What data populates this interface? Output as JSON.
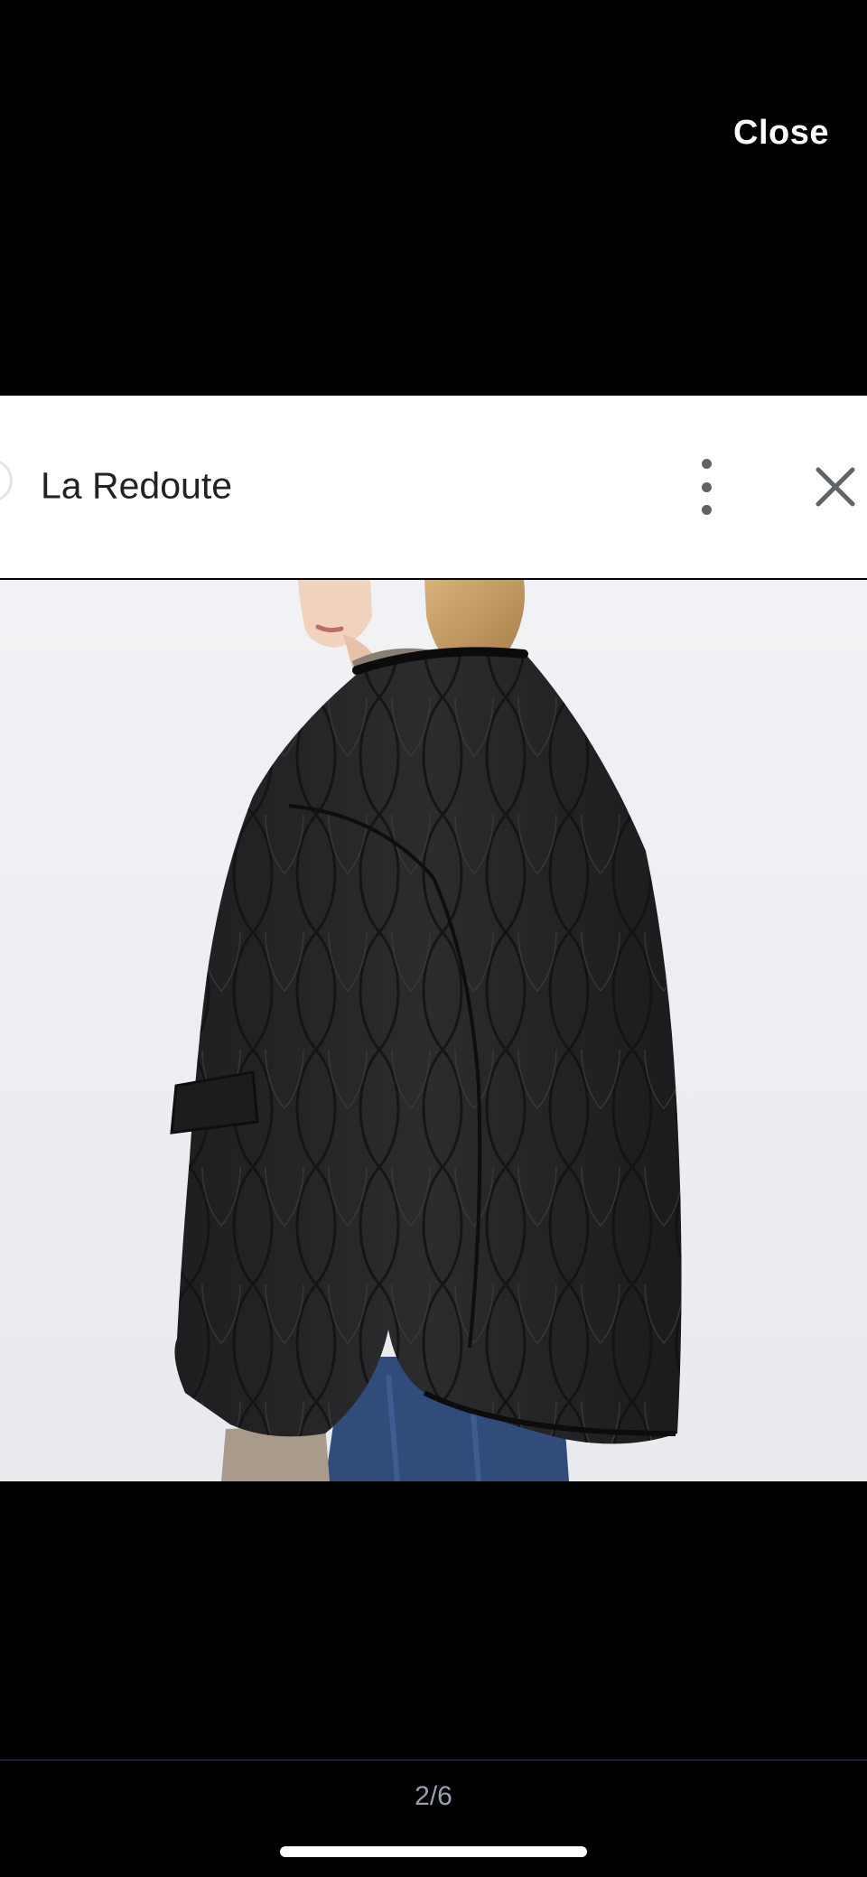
{
  "viewer": {
    "close_label": "Close",
    "page_counter": "2/6"
  },
  "card": {
    "site_name": "La Redoute",
    "menu_icon": "more-vert-icon",
    "close_icon": "close-icon"
  },
  "photo": {
    "subject": "black-quilted-jacket"
  },
  "colors": {
    "background": "#000000",
    "card_background": "#ffffff",
    "text_primary": "#222222",
    "icon_gray": "#5f6368",
    "counter_text": "#9aa0b2"
  }
}
